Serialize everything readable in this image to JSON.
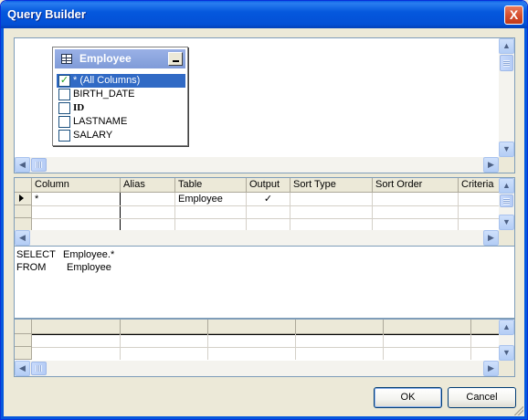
{
  "window": {
    "title": "Query Builder",
    "close_glyph": "X"
  },
  "diagram": {
    "table": {
      "name": "Employee",
      "columns": [
        {
          "label": "* (All Columns)",
          "checked": true,
          "selected": true
        },
        {
          "label": "BIRTH_DATE",
          "checked": false
        },
        {
          "label": "ID",
          "checked": false,
          "bold": true
        },
        {
          "label": "LASTNAME",
          "checked": false
        },
        {
          "label": "SALARY",
          "checked": false
        }
      ]
    }
  },
  "criteria_grid": {
    "headers": [
      "Column",
      "Alias",
      "Table",
      "Output",
      "Sort Type",
      "Sort Order",
      "Criteria"
    ],
    "rows": [
      {
        "column": "*",
        "alias": "",
        "table": "Employee",
        "output": "✓",
        "sort_type": "",
        "sort_order": "",
        "criteria": ""
      }
    ]
  },
  "sql": {
    "line1_kw": "SELECT",
    "line1_val": "Employee.*",
    "line2_kw": "FROM",
    "line2_val": "Employee"
  },
  "buttons": {
    "ok": "OK",
    "cancel": "Cancel"
  },
  "icons": {
    "scroll_up": "▲",
    "scroll_down": "▼",
    "scroll_left": "◀",
    "scroll_right": "▶",
    "check": "✓"
  }
}
